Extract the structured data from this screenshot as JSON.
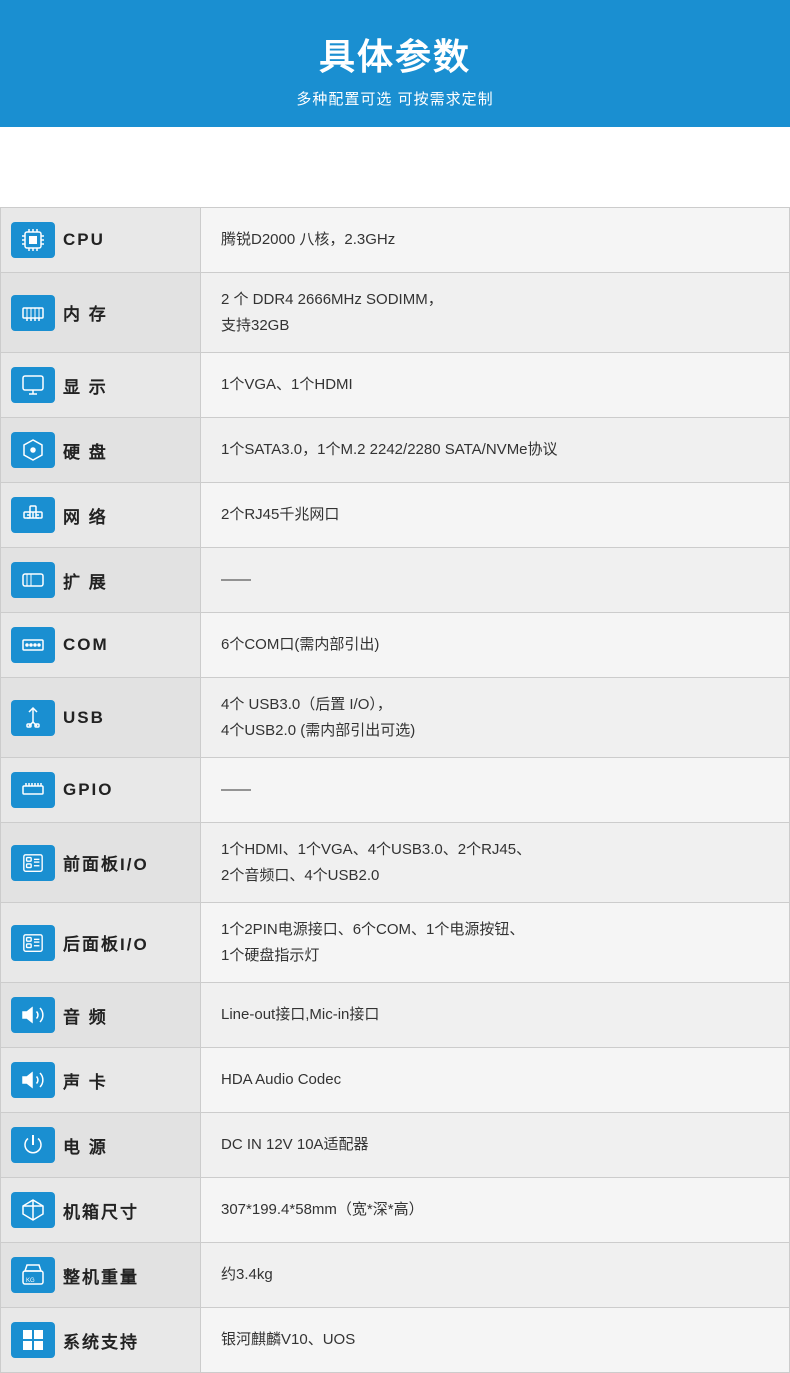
{
  "header": {
    "title": "具体参数",
    "subtitle": "多种配置可选 可按需求定制"
  },
  "rows": [
    {
      "id": "cpu",
      "icon": "🖥",
      "label": "CPU",
      "value": "腾锐D2000 八核，2.3GHz"
    },
    {
      "id": "memory",
      "icon": "📦",
      "label": "内 存",
      "value": "2 个 DDR4 2666MHz SODIMM，\n支持32GB"
    },
    {
      "id": "display",
      "icon": "🖵",
      "label": "显 示",
      "value": "1个VGA、1个HDMI"
    },
    {
      "id": "storage",
      "icon": "💾",
      "label": "硬 盘",
      "value": "1个SATA3.0，1个M.2 2242/2280 SATA/NVMe协议"
    },
    {
      "id": "network",
      "icon": "🌐",
      "label": "网 络",
      "value": "2个RJ45千兆网口"
    },
    {
      "id": "expand",
      "icon": "📺",
      "label": "扩 展",
      "value": "——"
    },
    {
      "id": "com",
      "icon": "🔌",
      "label": "COM",
      "value": "6个COM口(需内部引出)"
    },
    {
      "id": "usb",
      "icon": "⇆",
      "label": "USB",
      "value": "4个 USB3.0（后置 I/O），\n4个USB2.0 (需内部引出可选)"
    },
    {
      "id": "gpio",
      "icon": "⊟",
      "label": "GPIO",
      "value": "——"
    },
    {
      "id": "front-io",
      "icon": "⬜",
      "label": "前面板I/O",
      "value": "1个HDMI、1个VGA、4个USB3.0、2个RJ45、\n2个音频口、4个USB2.0"
    },
    {
      "id": "rear-io",
      "icon": "⬜",
      "label": "后面板I/O",
      "value": "1个2PIN电源接口、6个COM、1个电源按钮、\n1个硬盘指示灯"
    },
    {
      "id": "audio",
      "icon": "🔊",
      "label": "音 频",
      "value": "Line-out接口,Mic-in接口"
    },
    {
      "id": "soundcard",
      "icon": "🔊",
      "label": "声 卡",
      "value": "HDA Audio Codec"
    },
    {
      "id": "power",
      "icon": "⚡",
      "label": "电 源",
      "value": "DC IN 12V 10A适配器"
    },
    {
      "id": "chassis",
      "icon": "✂",
      "label": "机箱尺寸",
      "value": "307*199.4*58mm（宽*深*高）"
    },
    {
      "id": "weight",
      "icon": "⚖",
      "label": "整机重量",
      "value": "约3.4kg"
    },
    {
      "id": "os",
      "icon": "⊞",
      "label": "系统支持",
      "value": "银河麒麟V10、UOS"
    }
  ],
  "icons": {
    "cpu": "CPU",
    "memory": "MEM",
    "display": "VGA",
    "storage": "HDD",
    "network": "NET",
    "expand": "EXP",
    "com": "COM",
    "usb": "USB",
    "gpio": "GPIO",
    "front-io": "I/O",
    "rear-io": "I/O",
    "audio": "AUD",
    "soundcard": "AUD",
    "power": "PWR",
    "chassis": "DIM",
    "weight": "KG",
    "os": "OS"
  }
}
